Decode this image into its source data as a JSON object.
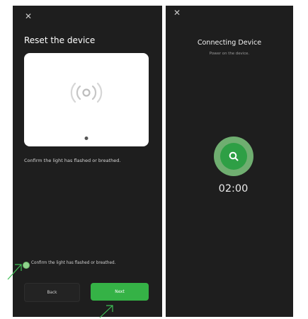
{
  "left_screen": {
    "close_icon": "close-icon",
    "title": "Reset the device",
    "card_icon": "nfc-signal-icon",
    "confirm_text": "Confirm the light has flashed or breathed.",
    "checkbox_label": "Confirm the light has flashed or breathed.",
    "checkbox_checked": true,
    "back_label": "Back",
    "next_label": "Next",
    "accent_color": "#35b246"
  },
  "right_screen": {
    "close_icon": "close-icon",
    "title": "Connecting Device",
    "subtitle": "Power on the device.",
    "search_icon": "search-icon",
    "timer": "02:00"
  }
}
